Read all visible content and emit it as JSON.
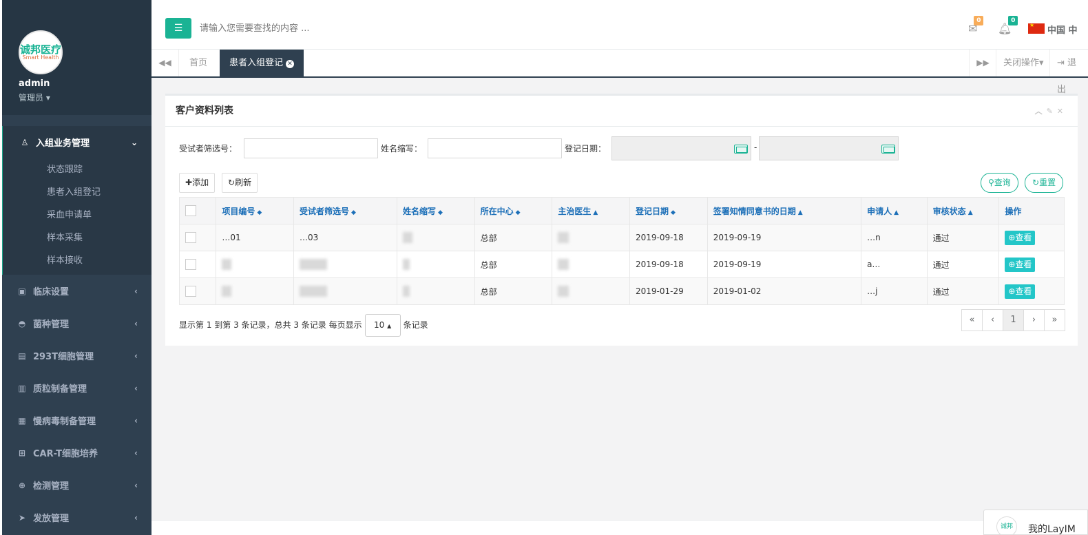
{
  "sidebar": {
    "logo_text": "诚邦医疗",
    "logo_sub": "Smart Health",
    "profile": {
      "name": "admin",
      "role": "管理员"
    },
    "menu": [
      {
        "label": "入组业务管理",
        "icon": "user-md-icon",
        "expanded": true,
        "children": [
          "状态跟踪",
          "患者入组登记",
          "采血申请单",
          "样本采集",
          "样本接收"
        ]
      },
      {
        "label": "临床设置",
        "icon": "save-icon"
      },
      {
        "label": "菌种管理",
        "icon": "bug-icon"
      },
      {
        "label": "293T细胞管理",
        "icon": "calendar-icon"
      },
      {
        "label": "质粒制备管理",
        "icon": "map-icon"
      },
      {
        "label": "慢病毒制备管理",
        "icon": "building-icon"
      },
      {
        "label": "CAR-T细胞培养",
        "icon": "medkit-icon"
      },
      {
        "label": "检测管理",
        "icon": "plus-square-icon"
      },
      {
        "label": "发放管理",
        "icon": "send-icon"
      }
    ]
  },
  "header": {
    "search_placeholder": "请输入您需要查找的内容 ...",
    "mail_count": "0",
    "bell_count": "0",
    "language": "中国 中"
  },
  "tabs": {
    "home": "首页",
    "active": "患者入组登记",
    "close_ops": "关闭操作",
    "logout": "退出"
  },
  "panel": {
    "title": "客户资料列表",
    "filters": {
      "screening_no_label": "受试者筛选号：",
      "name_abbr_label": "姓名缩写：",
      "reg_date_label": "登记日期：",
      "date_sep": "-"
    },
    "buttons": {
      "add": "添加",
      "refresh": "刷新",
      "query": "查询",
      "reset": "重置"
    },
    "table": {
      "headers": [
        "项目编号",
        "受试者筛选号",
        "姓名缩写",
        "所在中心",
        "主治医生",
        "登记日期",
        "签署知情同意书的日期",
        "申请人",
        "审核状态",
        "操作"
      ],
      "rows": [
        {
          "project_no": "…01",
          "screening_no": "…03",
          "center": "总部",
          "reg_date": "2019-09-18",
          "consent_date": "2019-09-19",
          "applicant": "…n",
          "status": "通过",
          "action": "查看"
        },
        {
          "project_no": "",
          "screening_no": "",
          "center": "总部",
          "reg_date": "2019-09-18",
          "consent_date": "2019-09-19",
          "applicant": "a…",
          "status": "通过",
          "action": "查看"
        },
        {
          "project_no": "",
          "screening_no": "",
          "center": "总部",
          "reg_date": "2019-01-29",
          "consent_date": "2019-01-02",
          "applicant": "…j",
          "status": "通过",
          "action": "查看"
        }
      ]
    },
    "pagination": {
      "info": "显示第 1 到第 3 条记录，总共 3 条记录 每页显示",
      "page_size": "10",
      "suffix": "条记录",
      "pages": [
        "«",
        "‹",
        "1",
        "›",
        "»"
      ]
    }
  },
  "im": {
    "title": "我的LayIM"
  }
}
